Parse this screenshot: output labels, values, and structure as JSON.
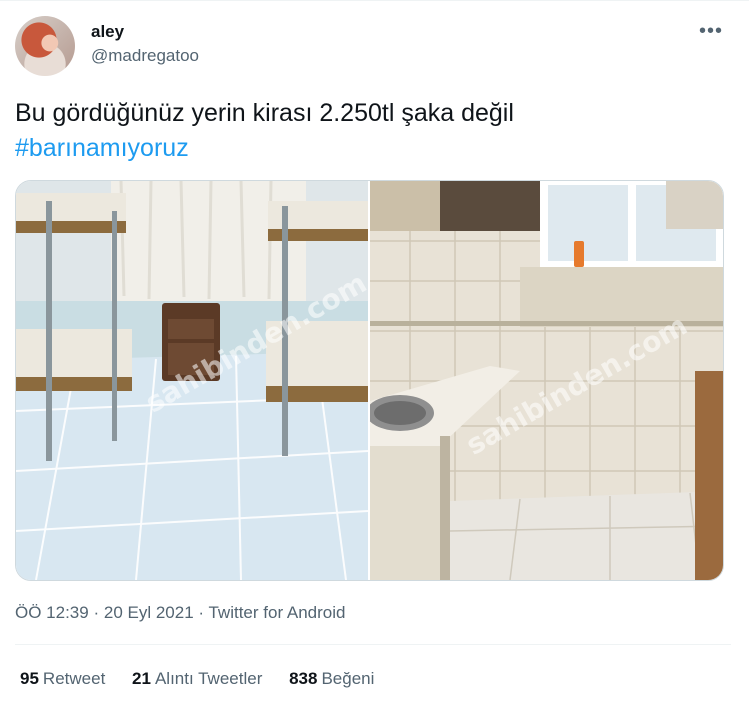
{
  "tweet": {
    "author": {
      "name": "aley",
      "handle": "@madregatoo"
    },
    "text": "Bu gördüğünüz yerin kirası 2.250tl şaka değil",
    "hashtag": "#barınamıyoruz",
    "media": {
      "left_photo_icon": "bunk-beds-room-photo",
      "right_photo_icon": "kitchen-sink-photo",
      "watermark": "sahibinden.com"
    },
    "meta": {
      "time": "ÖÖ 12:39",
      "sep1": "·",
      "date": "20 Eyl 2021",
      "sep2": "·",
      "source": "Twitter for Android"
    },
    "stats": {
      "retweets_count": "95",
      "retweets_label": "Retweet",
      "quotes_count": "21",
      "quotes_label": "Alıntı Tweetler",
      "likes_count": "838",
      "likes_label": "Beğeni"
    },
    "more_icon": "more-horizontal-icon",
    "colors": {
      "link": "#1d9bf0",
      "text": "#0f1419",
      "secondary": "#536471",
      "border": "#cfd9de"
    }
  }
}
